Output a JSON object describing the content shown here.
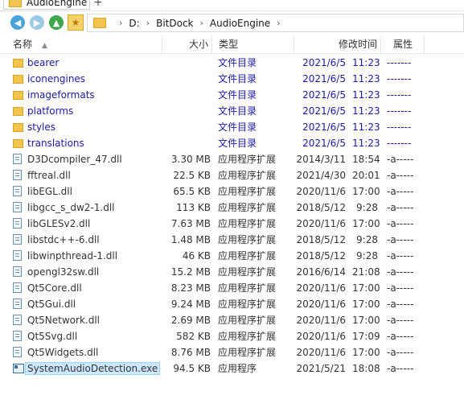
{
  "window": {
    "tab_title": "AudioEngine",
    "tab_add": "+"
  },
  "nav": {
    "breadcrumb": [
      "D:",
      "BitDock",
      "AudioEngine"
    ],
    "separator": "›",
    "icons": [
      "back-arrow-icon",
      "forward-arrow-icon",
      "up-arrow-icon",
      "favorite-star-icon"
    ]
  },
  "columns": {
    "name": "名称",
    "size": "大小",
    "type": "类型",
    "date": "修改时间",
    "attr": "属性",
    "sort_indicator": "▲"
  },
  "colors": {
    "folder_text": "#1a1aa6",
    "selection": "#cce8ff",
    "folder_icon": "#f1c44f"
  },
  "files": [
    {
      "kind": "folder",
      "name": "bearer",
      "size": "",
      "type": "文件目录",
      "date": "2021/6/5",
      "time": "11:23",
      "attr": "-------"
    },
    {
      "kind": "folder",
      "name": "iconengines",
      "size": "",
      "type": "文件目录",
      "date": "2021/6/5",
      "time": "11:23",
      "attr": "-------"
    },
    {
      "kind": "folder",
      "name": "imageformats",
      "size": "",
      "type": "文件目录",
      "date": "2021/6/5",
      "time": "11:23",
      "attr": "-------"
    },
    {
      "kind": "folder",
      "name": "platforms",
      "size": "",
      "type": "文件目录",
      "date": "2021/6/5",
      "time": "11:23",
      "attr": "-------"
    },
    {
      "kind": "folder",
      "name": "styles",
      "size": "",
      "type": "文件目录",
      "date": "2021/6/5",
      "time": "11:23",
      "attr": "-------"
    },
    {
      "kind": "folder",
      "name": "translations",
      "size": "",
      "type": "文件目录",
      "date": "2021/6/5",
      "time": "11:23",
      "attr": "-------"
    },
    {
      "kind": "dll",
      "name": "D3Dcompiler_47.dll",
      "size": "3.30 MB",
      "type": "应用程序扩展",
      "date": "2014/3/11",
      "time": "18:54",
      "attr": "-a-----"
    },
    {
      "kind": "dll",
      "name": "fftreal.dll",
      "size": "22.5 KB",
      "type": "应用程序扩展",
      "date": "2021/4/30",
      "time": "20:01",
      "attr": "-a-----"
    },
    {
      "kind": "dll",
      "name": "libEGL.dll",
      "size": "65.5 KB",
      "type": "应用程序扩展",
      "date": "2020/11/6",
      "time": "17:00",
      "attr": "-a-----"
    },
    {
      "kind": "dll",
      "name": "libgcc_s_dw2-1.dll",
      "size": "113 KB",
      "type": "应用程序扩展",
      "date": "2018/5/12",
      "time": "9:28",
      "attr": "-a-----"
    },
    {
      "kind": "dll",
      "name": "libGLESv2.dll",
      "size": "7.63 MB",
      "type": "应用程序扩展",
      "date": "2020/11/6",
      "time": "17:00",
      "attr": "-a-----"
    },
    {
      "kind": "dll",
      "name": "libstdc++-6.dll",
      "size": "1.48 MB",
      "type": "应用程序扩展",
      "date": "2018/5/12",
      "time": "9:28",
      "attr": "-a-----"
    },
    {
      "kind": "dll",
      "name": "libwinpthread-1.dll",
      "size": "46 KB",
      "type": "应用程序扩展",
      "date": "2018/5/12",
      "time": "9:28",
      "attr": "-a-----"
    },
    {
      "kind": "dll",
      "name": "opengl32sw.dll",
      "size": "15.2 MB",
      "type": "应用程序扩展",
      "date": "2016/6/14",
      "time": "21:08",
      "attr": "-a-----"
    },
    {
      "kind": "dll",
      "name": "Qt5Core.dll",
      "size": "8.23 MB",
      "type": "应用程序扩展",
      "date": "2020/11/6",
      "time": "17:00",
      "attr": "-a-----"
    },
    {
      "kind": "dll",
      "name": "Qt5Gui.dll",
      "size": "9.24 MB",
      "type": "应用程序扩展",
      "date": "2020/11/6",
      "time": "17:00",
      "attr": "-a-----"
    },
    {
      "kind": "dll",
      "name": "Qt5Network.dll",
      "size": "2.69 MB",
      "type": "应用程序扩展",
      "date": "2020/11/6",
      "time": "17:00",
      "attr": "-a-----"
    },
    {
      "kind": "dll",
      "name": "Qt5Svg.dll",
      "size": "582 KB",
      "type": "应用程序扩展",
      "date": "2020/11/6",
      "time": "17:09",
      "attr": "-a-----"
    },
    {
      "kind": "dll",
      "name": "Qt5Widgets.dll",
      "size": "8.76 MB",
      "type": "应用程序扩展",
      "date": "2020/11/6",
      "time": "17:00",
      "attr": "-a-----"
    },
    {
      "kind": "exe",
      "name": "SystemAudioDetection.exe",
      "size": "94.5 KB",
      "type": "应用程序",
      "date": "2021/5/21",
      "time": "18:08",
      "attr": "-a-----",
      "selected": true
    }
  ]
}
